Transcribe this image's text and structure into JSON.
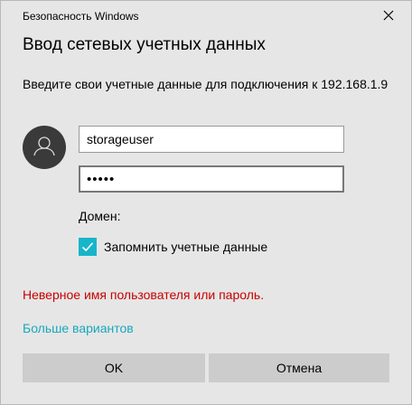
{
  "window": {
    "title": "Безопасность Windows",
    "close_icon": "close-icon"
  },
  "dialog": {
    "heading": "Ввод сетевых учетных данных",
    "prompt": "Введите свои учетные данные для подключения к 192.168.1.9"
  },
  "avatar": {
    "icon": "user-silhouette-icon"
  },
  "fields": {
    "username_value": "storageuser",
    "password_value": "•••••",
    "domain_label": "Домен:"
  },
  "remember": {
    "label": "Запомнить учетные данные",
    "checked": true
  },
  "error": {
    "message": "Неверное имя пользователя или пароль."
  },
  "more_options": {
    "label": "Больше вариантов"
  },
  "buttons": {
    "ok_label": "OK",
    "cancel_label": "Отмена"
  },
  "colors": {
    "accent": "#17b5c9",
    "error": "#c80000",
    "link": "#17a8bd",
    "background": "#e6e6e6",
    "button": "#cccccc"
  }
}
